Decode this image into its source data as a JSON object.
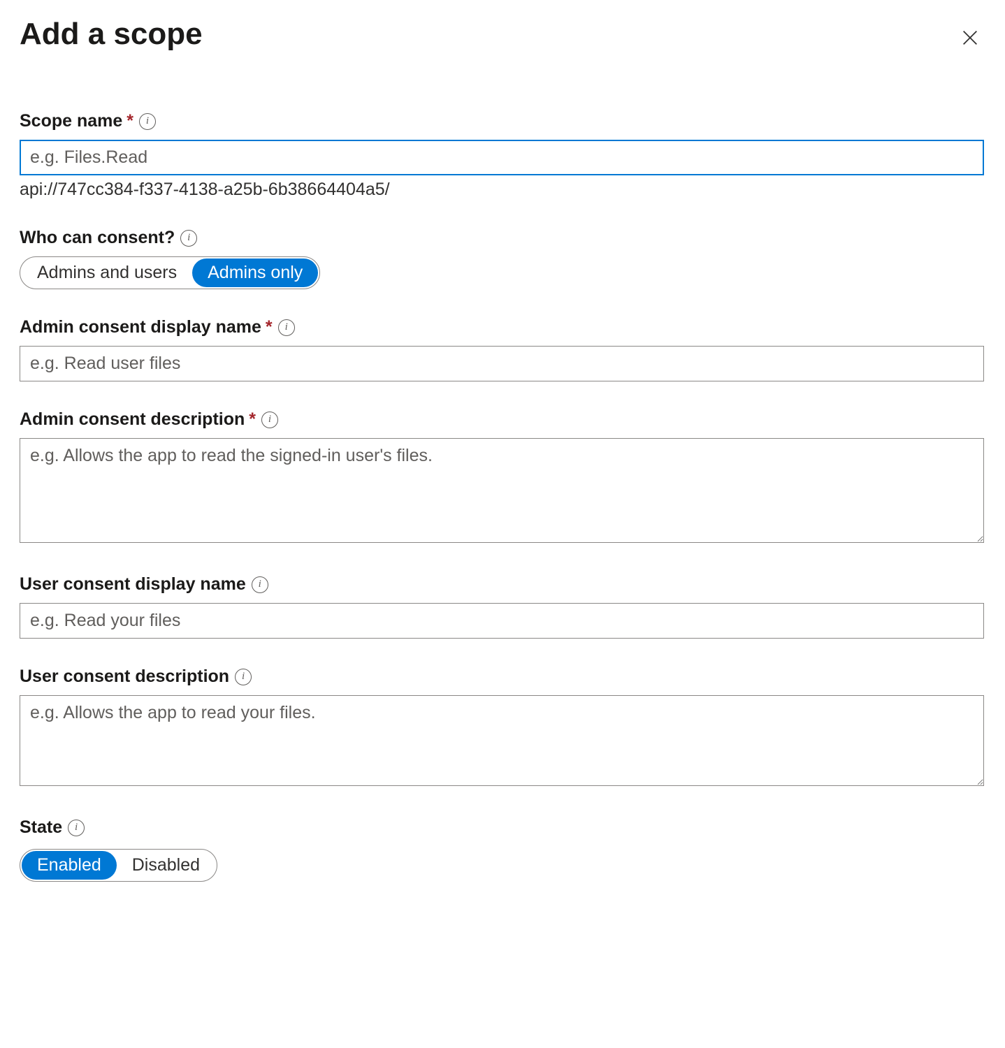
{
  "header": {
    "title": "Add a scope"
  },
  "fields": {
    "scopeName": {
      "label": "Scope name",
      "required": true,
      "placeholder": "e.g. Files.Read",
      "value": "",
      "helper": "api://747cc384-f337-4138-a25b-6b38664404a5/"
    },
    "whoCanConsent": {
      "label": "Who can consent?",
      "options": [
        "Admins and users",
        "Admins only"
      ],
      "selected": "Admins only"
    },
    "adminConsentDisplayName": {
      "label": "Admin consent display name",
      "required": true,
      "placeholder": "e.g. Read user files",
      "value": ""
    },
    "adminConsentDescription": {
      "label": "Admin consent description",
      "required": true,
      "placeholder": "e.g. Allows the app to read the signed-in user's files.",
      "value": ""
    },
    "userConsentDisplayName": {
      "label": "User consent display name",
      "required": false,
      "placeholder": "e.g. Read your files",
      "value": ""
    },
    "userConsentDescription": {
      "label": "User consent description",
      "required": false,
      "placeholder": "e.g. Allows the app to read your files.",
      "value": ""
    },
    "state": {
      "label": "State",
      "options": [
        "Enabled",
        "Disabled"
      ],
      "selected": "Enabled"
    }
  }
}
